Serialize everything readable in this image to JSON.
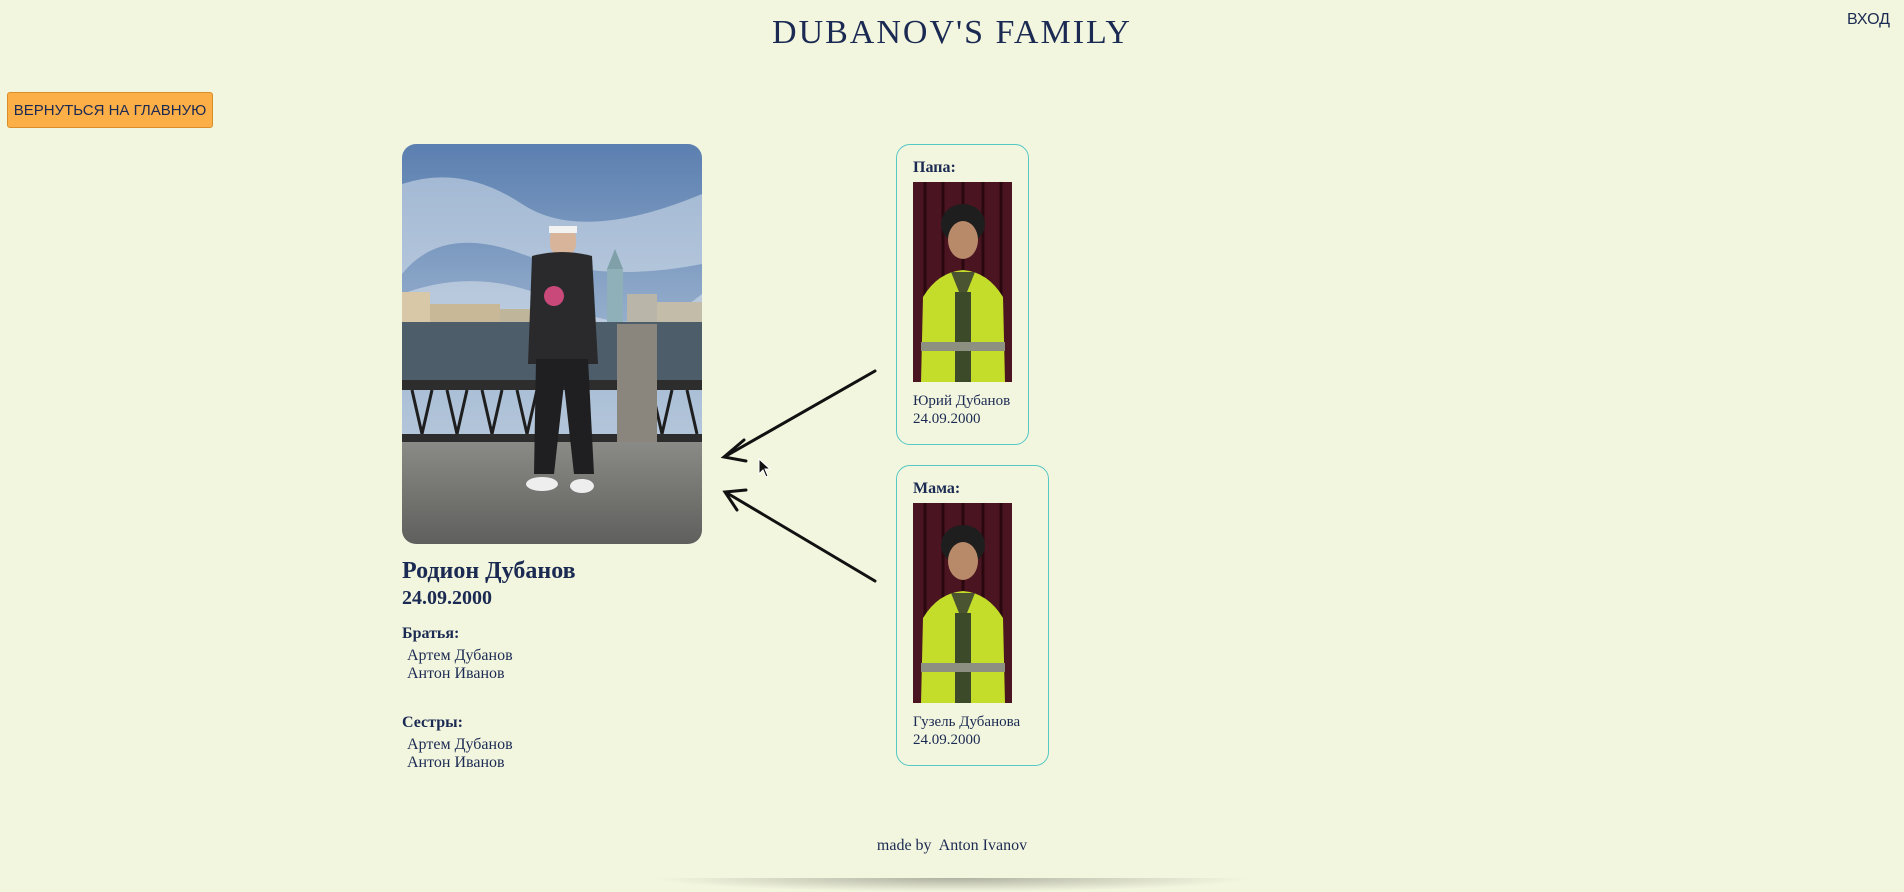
{
  "header": {
    "title": "DUBANOV'S FAMILY",
    "login_label": "ВХОД"
  },
  "nav": {
    "back_label": "ВЕРНУТЬСЯ НА ГЛАВНУЮ"
  },
  "person": {
    "name": "Родион Дубанов",
    "date": "24.09.2000",
    "brothers_title": "Братья:",
    "brothers": [
      "Артем Дубанов",
      "Антон Иванов"
    ],
    "sisters_title": "Сестры:",
    "sisters": [
      "Артем Дубанов",
      "Антон Иванов"
    ]
  },
  "parents": {
    "father": {
      "label": "Папа:",
      "name": "Юрий Дубанов",
      "date": "24.09.2000"
    },
    "mother": {
      "label": "Мама:",
      "name": "Гузель Дубанова",
      "date": "24.09.2000"
    }
  },
  "footer": {
    "text": "made by  Anton Ivanov"
  },
  "colors": {
    "background": "#f3f6df",
    "text": "#1b2a52",
    "button": "#fcae47",
    "card_border": "#55c7c4"
  }
}
